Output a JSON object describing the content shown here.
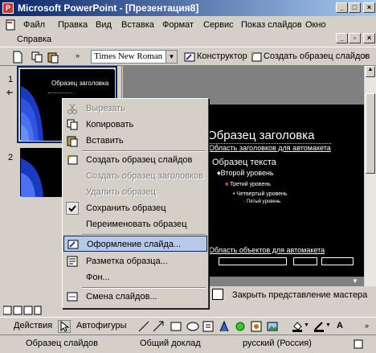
{
  "app": {
    "title": "Microsoft PowerPoint - [Презентация8]"
  },
  "menu": {
    "items": [
      "Файл",
      "Правка",
      "Вид",
      "Вставка",
      "Формат",
      "Сервис",
      "Показ слайдов",
      "Окно",
      "Справка"
    ]
  },
  "toolbar": {
    "font": "Times New Roman",
    "designer": "Конструктор",
    "create_master": "Создать образец слайдов"
  },
  "slides": {
    "nums": [
      "1",
      "2"
    ],
    "thumb1_title": "Образец заголовка"
  },
  "slide": {
    "title": "Образец заголовка",
    "subtitle": "Область заголовков для автомакета",
    "body": "Образец текста",
    "level2": "Второй уровень",
    "level3": "Третий уровень",
    "level4": "Четвертый уровень",
    "level5": "Пятый уровень",
    "footer": "Область объектов для автомакета"
  },
  "context_menu": {
    "items": [
      {
        "label": "Вырезать",
        "disabled": true
      },
      {
        "label": "Копировать",
        "disabled": false
      },
      {
        "label": "Вставить",
        "disabled": false
      },
      {
        "label": "Создать образец слайдов",
        "disabled": false
      },
      {
        "label": "Создать образец заголовков",
        "disabled": true
      },
      {
        "label": "Удалить образец",
        "disabled": true
      },
      {
        "label": "Сохранить образец",
        "disabled": false
      },
      {
        "label": "Переименовать образец",
        "disabled": false
      },
      {
        "label": "Оформление слайда...",
        "disabled": false,
        "highlight": true
      },
      {
        "label": "Разметка образца...",
        "disabled": false
      },
      {
        "label": "Фон...",
        "disabled": false
      },
      {
        "label": "Смена слайдов...",
        "disabled": false
      }
    ]
  },
  "master_toolbar": {
    "close": "Закрыть представление мастера"
  },
  "drawing": {
    "actions": "Действия",
    "autoshapes": "Автофигуры"
  },
  "status": {
    "view": "Образец слайдов",
    "design": "Общий доклад",
    "language": "русский (Россия)"
  },
  "colors": {
    "accent": "#0a246a",
    "highlight": "#b8c8e8",
    "slide_bg": "#000000"
  }
}
